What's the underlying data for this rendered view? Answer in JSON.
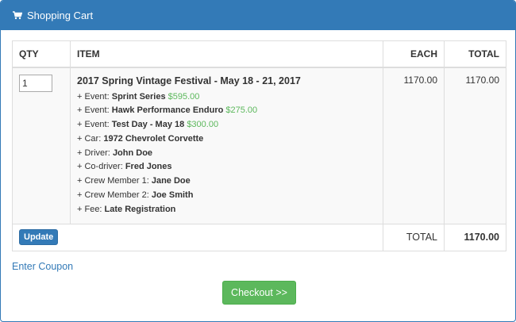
{
  "header": {
    "title": "Shopping Cart",
    "icon": "shopping-cart-icon"
  },
  "table": {
    "columns": {
      "qty": "QTY",
      "item": "ITEM",
      "each": "EACH",
      "total": "TOTAL"
    },
    "row": {
      "qty": "1",
      "title": "2017 Spring Vintage Festival - May 18 - 21, 2017",
      "each": "1170.00",
      "total": "1170.00",
      "lines": [
        {
          "prefix": "+ Event: ",
          "value": "Sprint Series",
          "price": "$595.00"
        },
        {
          "prefix": "+ Event: ",
          "value": "Hawk Performance Enduro",
          "price": "$275.00"
        },
        {
          "prefix": "+ Event: ",
          "value": "Test Day - May 18",
          "price": "$300.00"
        },
        {
          "prefix": "+ Car: ",
          "value": "1972 Chevrolet Corvette"
        },
        {
          "prefix": "+ Driver: ",
          "value": "John Doe"
        },
        {
          "prefix": "+ Co-driver: ",
          "value": "Fred Jones"
        },
        {
          "prefix": "+ Crew Member 1: ",
          "value": "Jane Doe"
        },
        {
          "prefix": "+ Crew Member 2: ",
          "value": "Joe Smith"
        },
        {
          "prefix": "+ Fee: ",
          "value": "Late Registration"
        }
      ]
    },
    "footer": {
      "update_label": "Update",
      "total_label": "TOTAL",
      "total_value": "1170.00"
    }
  },
  "coupon_label": "Enter Coupon",
  "checkout_label": "Checkout >>",
  "colors": {
    "primary": "#337ab7",
    "success": "#5cb85c"
  }
}
